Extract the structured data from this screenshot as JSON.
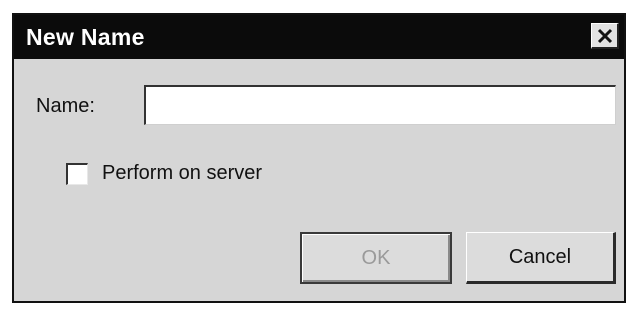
{
  "dialog": {
    "title": "New Name",
    "close_icon": "close-icon"
  },
  "form": {
    "name_label": "Name:",
    "name_value": "",
    "perform_on_server_label": "Perform on server",
    "perform_on_server_checked": false
  },
  "buttons": {
    "ok_label": "OK",
    "ok_enabled": false,
    "cancel_label": "Cancel"
  }
}
